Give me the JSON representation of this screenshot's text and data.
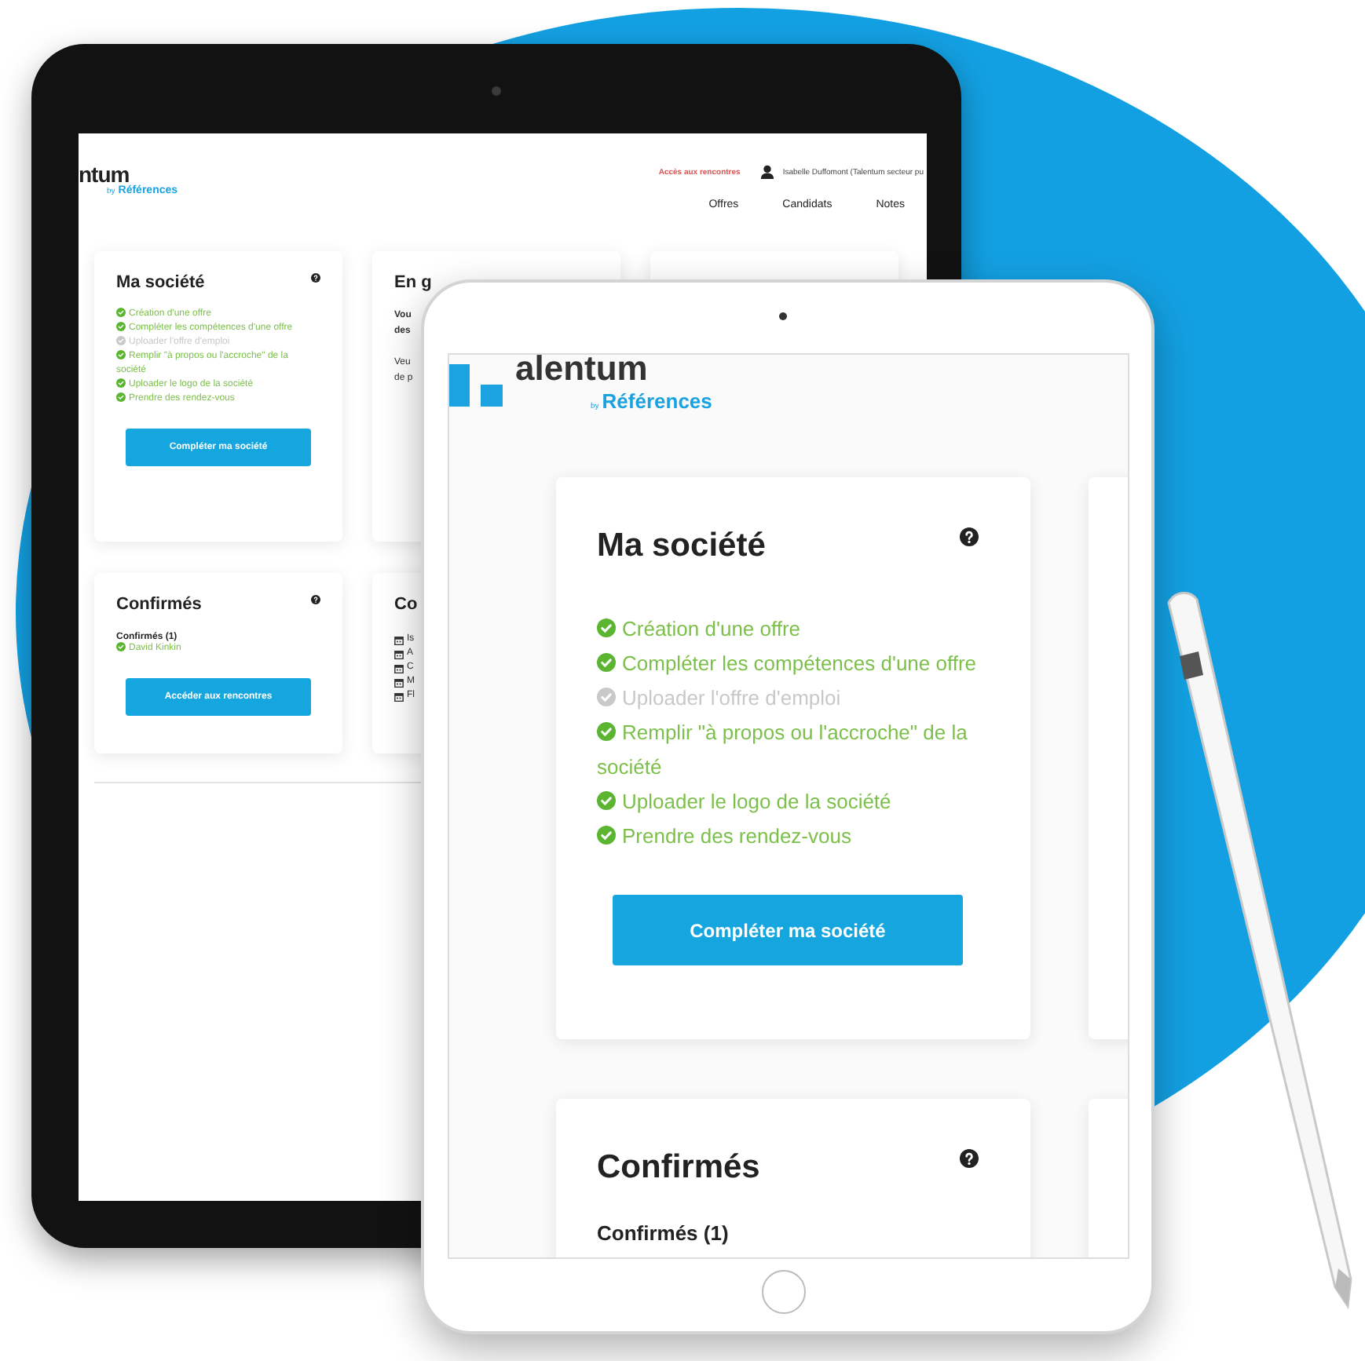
{
  "back_tablet": {
    "header": {
      "logo_text": "ntum",
      "logo_by": "by",
      "logo_brand": "Références",
      "meeting_link": "Accès aux rencontres",
      "user_name": "Isabelle Duffomont (Talentum secteur pu"
    },
    "nav": [
      {
        "label": "Offres"
      },
      {
        "label": "Candidats"
      },
      {
        "label": "Notes"
      }
    ],
    "cards": [
      {
        "kind": "checklist",
        "title": "Ma société",
        "items": [
          {
            "text": "Création d'une offre",
            "done": true
          },
          {
            "text": "Compléter les compétences d'une offre",
            "done": true
          },
          {
            "text": "Uploader l'offre d'emploi",
            "done": false
          },
          {
            "text": "Remplir \"à propos ou l'accroche\" de la société",
            "done": true
          },
          {
            "text": "Uploader le logo de la société",
            "done": true
          },
          {
            "text": "Prendre des rendez-vous",
            "done": true
          }
        ],
        "button": "Compléter ma société"
      },
      {
        "kind": "intro",
        "title": "En g",
        "lines": [
          {
            "text": "Vou",
            "bold": true
          },
          {
            "text": "des",
            "bold": true
          },
          {
            "text": "Veu",
            "bold": false
          },
          {
            "text": "de p",
            "bold": false
          }
        ]
      },
      {
        "kind": "blank"
      },
      {
        "kind": "confirmed",
        "title": "Confirmés",
        "subtitle": "Confirmés (1)",
        "people": [
          "David Kinkin"
        ],
        "button": "Accéder aux rencontres"
      },
      {
        "kind": "calendar",
        "title": "Co",
        "entries": [
          "Is",
          "A",
          "C",
          "M",
          "Fl"
        ]
      }
    ]
  },
  "front_tablet": {
    "logo_text": "alentum",
    "logo_by": "by",
    "logo_brand": "Références",
    "cards": [
      {
        "kind": "checklist",
        "title": "Ma société",
        "items": [
          {
            "text": "Création d'une offre",
            "done": true
          },
          {
            "text": "Compléter les compétences d'une offre",
            "done": true
          },
          {
            "text": "Uploader l'offre d'emploi",
            "done": false
          },
          {
            "text": "Remplir \"à propos ou l'accroche\" de la société",
            "done": true
          },
          {
            "text": "Uploader le logo de la société",
            "done": true
          },
          {
            "text": "Prendre des rendez-vous",
            "done": true
          }
        ],
        "button": "Compléter ma société"
      },
      {
        "kind": "blank"
      },
      {
        "kind": "confirmed",
        "title": "Confirmés",
        "subtitle": "Confirmés (1)"
      },
      {
        "kind": "blank"
      }
    ]
  }
}
